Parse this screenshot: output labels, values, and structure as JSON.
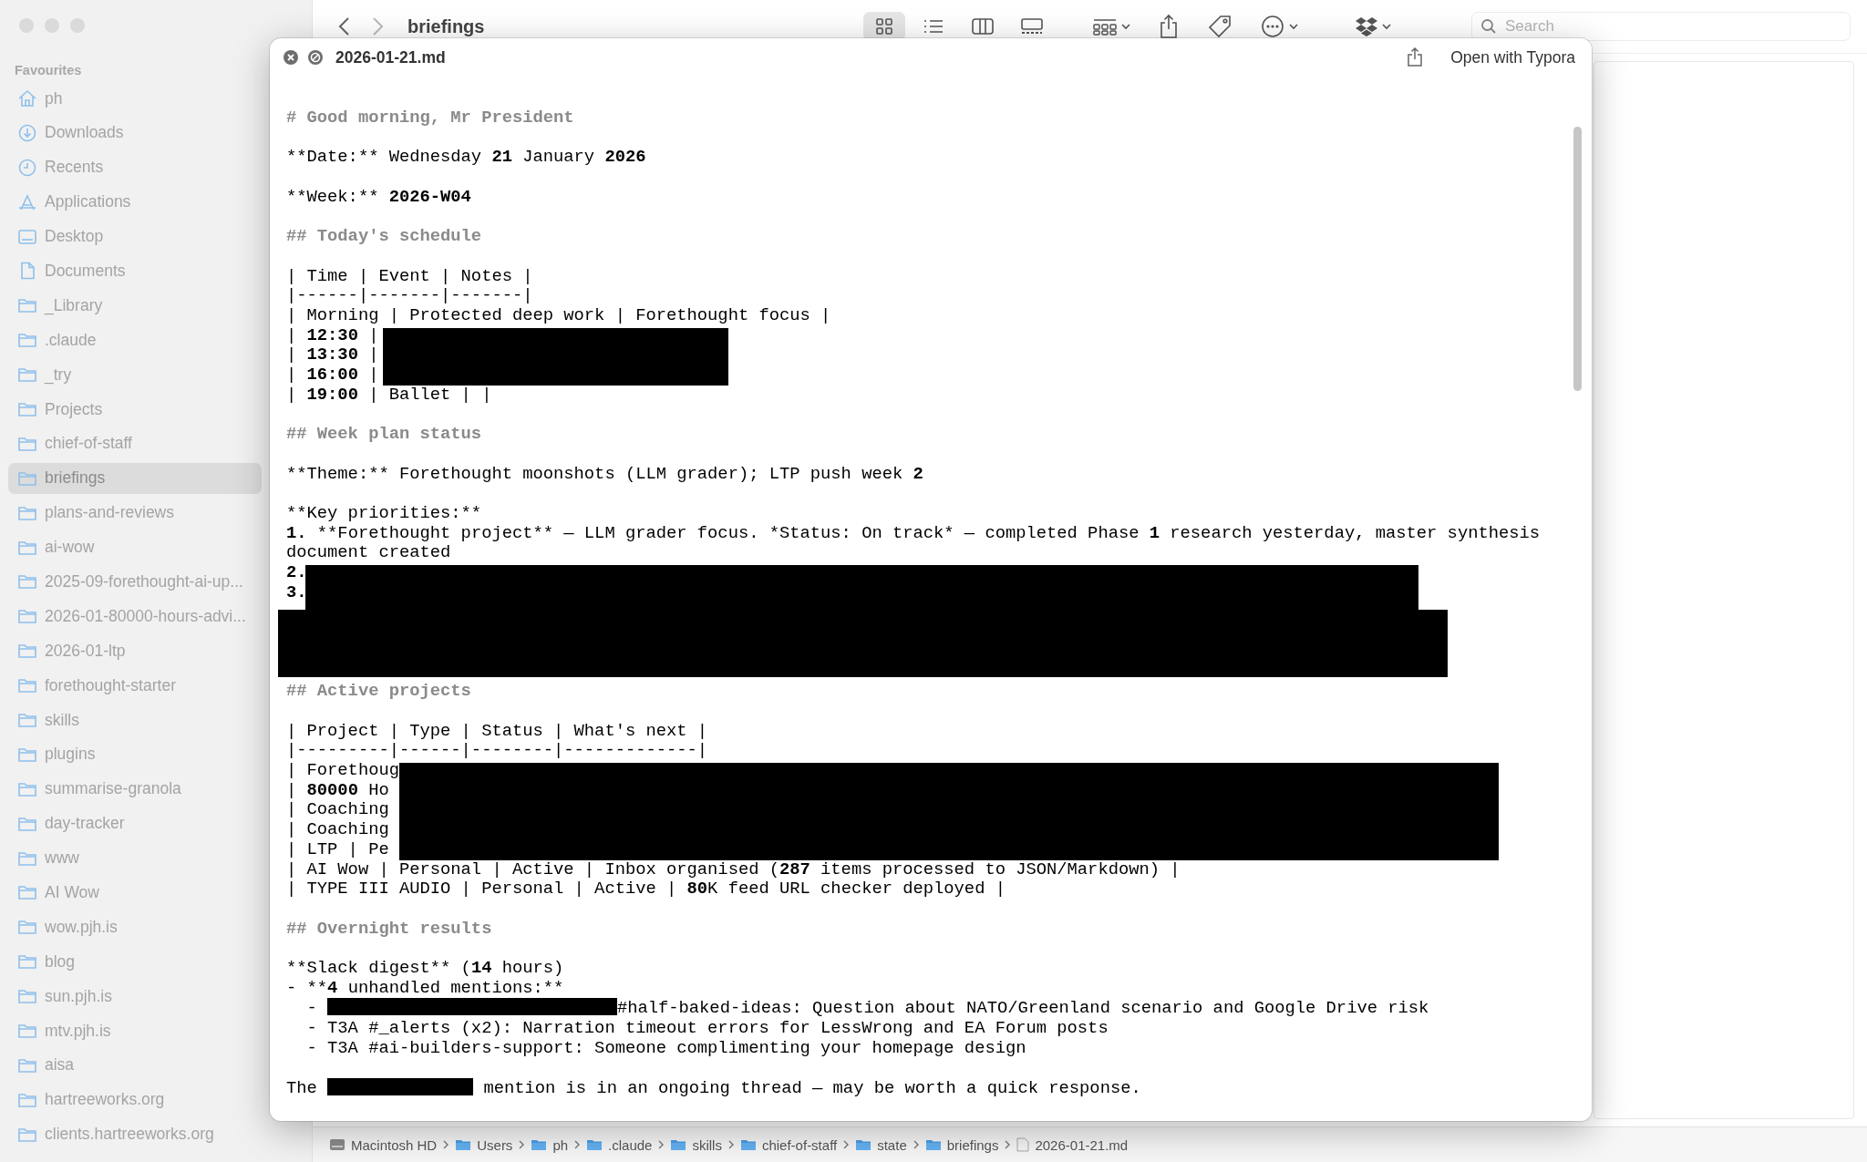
{
  "sidebar": {
    "section": "Favourites",
    "items": [
      {
        "label": "ph",
        "kind": "home",
        "selected": false
      },
      {
        "label": "Downloads",
        "kind": "download",
        "selected": false
      },
      {
        "label": "Recents",
        "kind": "recent",
        "selected": false
      },
      {
        "label": "Applications",
        "kind": "applications",
        "selected": false
      },
      {
        "label": "Desktop",
        "kind": "desktop",
        "selected": false
      },
      {
        "label": "Documents",
        "kind": "document",
        "selected": false
      },
      {
        "label": "_Library",
        "kind": "folder",
        "selected": false
      },
      {
        "label": ".claude",
        "kind": "folder",
        "selected": false
      },
      {
        "label": "_try",
        "kind": "folder",
        "selected": false
      },
      {
        "label": "Projects",
        "kind": "folder",
        "selected": false
      },
      {
        "label": "chief-of-staff",
        "kind": "folder",
        "selected": false
      },
      {
        "label": "briefings",
        "kind": "folder",
        "selected": true
      },
      {
        "label": "plans-and-reviews",
        "kind": "folder",
        "selected": false
      },
      {
        "label": "ai-wow",
        "kind": "folder",
        "selected": false
      },
      {
        "label": "2025-09-forethought-ai-up...",
        "kind": "folder",
        "selected": false
      },
      {
        "label": "2026-01-80000-hours-advi...",
        "kind": "folder",
        "selected": false
      },
      {
        "label": "2026-01-ltp",
        "kind": "folder",
        "selected": false
      },
      {
        "label": "forethought-starter",
        "kind": "folder",
        "selected": false
      },
      {
        "label": "skills",
        "kind": "folder",
        "selected": false
      },
      {
        "label": "plugins",
        "kind": "folder",
        "selected": false
      },
      {
        "label": "summarise-granola",
        "kind": "folder",
        "selected": false
      },
      {
        "label": "day-tracker",
        "kind": "folder",
        "selected": false
      },
      {
        "label": "www",
        "kind": "folder",
        "selected": false
      },
      {
        "label": "AI Wow",
        "kind": "folder",
        "selected": false
      },
      {
        "label": "wow.pjh.is",
        "kind": "folder",
        "selected": false
      },
      {
        "label": "blog",
        "kind": "folder",
        "selected": false
      },
      {
        "label": "sun.pjh.is",
        "kind": "folder",
        "selected": false
      },
      {
        "label": "mtv.pjh.is",
        "kind": "folder",
        "selected": false
      },
      {
        "label": "aisa",
        "kind": "folder",
        "selected": false
      },
      {
        "label": "hartreeworks.org",
        "kind": "folder",
        "selected": false
      },
      {
        "label": "clients.hartreeworks.org",
        "kind": "folder",
        "selected": false
      }
    ]
  },
  "toolbar": {
    "title": "briefings",
    "views": [
      {
        "kind": "icons",
        "selected": true
      },
      {
        "kind": "list",
        "selected": false
      },
      {
        "kind": "columns",
        "selected": false
      },
      {
        "kind": "gallery",
        "selected": false
      }
    ],
    "search": {
      "placeholder": "Search"
    }
  },
  "preview": {
    "file_name": "2026-01-21.md",
    "open_with": "Open with Typora",
    "lines": [
      {
        "kind": "heading",
        "text": "# Good morning, Mr President"
      },
      {
        "kind": "blank"
      },
      {
        "kind": "text",
        "parts": [
          {
            "text": "**Date:** Wednesday ",
            "bold": false
          },
          {
            "text": "21",
            "bold": true
          },
          {
            "text": " January ",
            "bold": false
          },
          {
            "text": "2026",
            "bold": true
          }
        ]
      },
      {
        "kind": "blank"
      },
      {
        "kind": "text",
        "parts": [
          {
            "text": "**Week:** ",
            "bold": false
          },
          {
            "text": "2026-W04",
            "bold": true
          }
        ]
      },
      {
        "kind": "blank"
      },
      {
        "kind": "heading",
        "text": "## Today's schedule"
      },
      {
        "kind": "blank"
      },
      {
        "kind": "text",
        "parts": [
          {
            "text": "| Time | Event | Notes |",
            "bold": false
          }
        ]
      },
      {
        "kind": "text",
        "parts": [
          {
            "text": "|------|-------|-------|",
            "bold": false
          }
        ]
      },
      {
        "kind": "text",
        "parts": [
          {
            "text": "| Morning | Protected deep work | Forethought focus |",
            "bold": false
          }
        ]
      },
      {
        "kind": "masked-narrow",
        "rows": [
          [
            {
              "text": "| ",
              "bold": false
            },
            {
              "text": "12:30",
              "bold": true
            },
            {
              "text": " |",
              "bold": false
            }
          ],
          [
            {
              "text": "| ",
              "bold": false
            },
            {
              "text": "13:30",
              "bold": true
            },
            {
              "text": " |",
              "bold": false
            }
          ],
          [
            {
              "text": "| ",
              "bold": false
            },
            {
              "text": "16:00",
              "bold": true
            },
            {
              "text": " |",
              "bold": false
            }
          ]
        ]
      },
      {
        "kind": "text",
        "parts": [
          {
            "text": "| ",
            "bold": false
          },
          {
            "text": "19:00",
            "bold": true
          },
          {
            "text": " | Ballet | |",
            "bold": false
          }
        ]
      },
      {
        "kind": "blank"
      },
      {
        "kind": "heading",
        "text": "## Week plan status"
      },
      {
        "kind": "blank"
      },
      {
        "kind": "text",
        "parts": [
          {
            "text": "**Theme:** Forethought moonshots (LLM grader); LTP push week ",
            "bold": false
          },
          {
            "text": "2",
            "bold": true
          }
        ]
      },
      {
        "kind": "blank"
      },
      {
        "kind": "text",
        "parts": [
          {
            "text": "**Key priorities:**",
            "bold": false
          }
        ]
      },
      {
        "kind": "text",
        "parts": [
          {
            "text": "1.",
            "bold": true
          },
          {
            "text": " **Forethought project** — LLM grader focus. *Status: On track* — completed Phase ",
            "bold": false
          },
          {
            "text": "1",
            "bold": true
          },
          {
            "text": " research yesterday, master synthesis",
            "bold": false
          }
        ]
      },
      {
        "kind": "text",
        "parts": [
          {
            "text": "document created",
            "bold": false
          }
        ]
      },
      {
        "kind": "masked-wide",
        "rows": [
          [
            {
              "text": "2.",
              "bold": true
            }
          ],
          [
            {
              "text": "3.",
              "bold": true
            }
          ]
        ]
      },
      {
        "kind": "masked-block"
      },
      {
        "kind": "heading",
        "text": "## Active projects"
      },
      {
        "kind": "blank"
      },
      {
        "kind": "text",
        "parts": [
          {
            "text": "| Project | Type | Status | What's next |",
            "bold": false
          }
        ]
      },
      {
        "kind": "text",
        "parts": [
          {
            "text": "|---------|------|--------|-------------|",
            "bold": false
          }
        ]
      },
      {
        "kind": "masked-table",
        "rows": [
          [
            {
              "text": "| Forethoug",
              "bold": false
            }
          ],
          [
            {
              "text": "| ",
              "bold": false
            },
            {
              "text": "80000",
              "bold": true
            },
            {
              "text": " Ho",
              "bold": false
            }
          ],
          [
            {
              "text": "| Coaching",
              "bold": false
            }
          ],
          [
            {
              "text": "| Coaching",
              "bold": false
            }
          ],
          [
            {
              "text": "| LTP | Pe",
              "bold": false
            }
          ]
        ]
      },
      {
        "kind": "text",
        "parts": [
          {
            "text": "| AI Wow | Personal | Active | Inbox organised (",
            "bold": false
          },
          {
            "text": "287",
            "bold": true
          },
          {
            "text": " items processed to JSON/Markdown) |",
            "bold": false
          }
        ]
      },
      {
        "kind": "text",
        "parts": [
          {
            "text": "| TYPE III AUDIO | Personal | Active | ",
            "bold": false
          },
          {
            "text": "80",
            "bold": true
          },
          {
            "text": "K feed URL checker deployed |",
            "bold": false
          }
        ]
      },
      {
        "kind": "blank"
      },
      {
        "kind": "heading",
        "text": "## Overnight results"
      },
      {
        "kind": "blank"
      },
      {
        "kind": "text",
        "parts": [
          {
            "text": "**Slack digest** (",
            "bold": false
          },
          {
            "text": "14",
            "bold": true
          },
          {
            "text": " hours)",
            "bold": false
          }
        ]
      },
      {
        "kind": "text",
        "parts": [
          {
            "text": "- **",
            "bold": false
          },
          {
            "text": "4",
            "bold": true
          },
          {
            "text": " unhandled mentions:**",
            "bold": false
          }
        ]
      },
      {
        "kind": "masked-inline-long",
        "before": "  - ",
        "after": "#half-baked-ideas: Question about NATO/Greenland scenario and Google Drive risk"
      },
      {
        "kind": "text",
        "parts": [
          {
            "text": "  - T3A #_alerts (x2): Narration timeout errors for LessWrong and EA Forum posts",
            "bold": false
          }
        ]
      },
      {
        "kind": "text",
        "parts": [
          {
            "text": "  - T3A #ai-builders-support: Someone complimenting your homepage design",
            "bold": false
          }
        ]
      },
      {
        "kind": "blank"
      },
      {
        "kind": "masked-inline-short",
        "before": "The ",
        "after": " mention is in an ongoing thread — may be worth a quick response."
      }
    ]
  },
  "path_bar": [
    {
      "label": "Macintosh HD",
      "kind": "disk"
    },
    {
      "label": "Users",
      "kind": "folder"
    },
    {
      "label": "ph",
      "kind": "folder"
    },
    {
      "label": ".claude",
      "kind": "folder"
    },
    {
      "label": "skills",
      "kind": "folder"
    },
    {
      "label": "chief-of-staff",
      "kind": "folder"
    },
    {
      "label": "state",
      "kind": "folder"
    },
    {
      "label": "briefings",
      "kind": "folder"
    },
    {
      "label": "2026-01-21.md",
      "kind": "file"
    }
  ]
}
